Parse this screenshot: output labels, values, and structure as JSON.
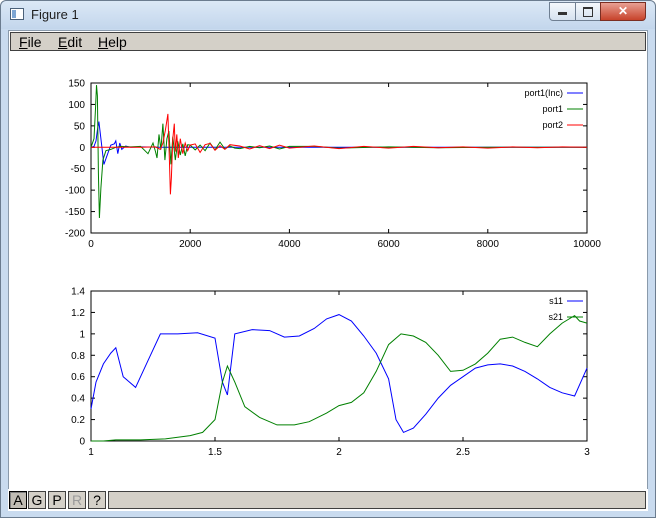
{
  "window": {
    "title": "Figure 1",
    "buttons": {
      "minimize": "minimize",
      "maximize": "maximize",
      "close": "✕"
    }
  },
  "menu": [
    {
      "label": "File",
      "mnemonic": "F",
      "rest": "ile"
    },
    {
      "label": "Edit",
      "mnemonic": "E",
      "rest": "dit"
    },
    {
      "label": "Help",
      "mnemonic": "H",
      "rest": "elp"
    }
  ],
  "toolbar": [
    {
      "label": "A",
      "state": "pressed"
    },
    {
      "label": "G",
      "state": "normal"
    },
    {
      "label": "P",
      "state": "normal"
    },
    {
      "label": "R",
      "state": "disabled"
    },
    {
      "label": "?",
      "state": "normal"
    }
  ],
  "colors": {
    "blue": "#0000ff",
    "green": "#008000",
    "red": "#ff0000"
  },
  "chart_data": [
    {
      "type": "line",
      "xlim": [
        0,
        10000
      ],
      "ylim": [
        -200,
        150
      ],
      "xticks": [
        0,
        2000,
        4000,
        6000,
        8000,
        10000
      ],
      "yticks": [
        -200,
        -150,
        -100,
        -50,
        0,
        50,
        100,
        150
      ],
      "legend_position": "top-right",
      "series": [
        {
          "name": "port1(Inc)",
          "color": "#0000ff",
          "x": [
            0,
            60,
            100,
            130,
            160,
            200,
            260,
            320,
            400,
            470,
            500,
            540,
            580,
            620,
            700,
            800,
            1000,
            1400,
            2000,
            3000,
            5000,
            7000,
            10000
          ],
          "y": [
            0,
            2,
            15,
            40,
            60,
            20,
            -40,
            -20,
            5,
            8,
            15,
            -15,
            10,
            -5,
            3,
            0,
            1,
            0,
            0,
            0,
            0,
            0,
            0
          ]
        },
        {
          "name": "port1",
          "color": "#008000",
          "x": [
            0,
            60,
            90,
            110,
            130,
            150,
            170,
            200,
            240,
            300,
            400,
            500,
            600,
            800,
            1000,
            1150,
            1250,
            1300,
            1330,
            1370,
            1410,
            1450,
            1490,
            1530,
            1570,
            1610,
            1650,
            1700,
            1750,
            1800,
            1850,
            1900,
            1950,
            2000,
            2100,
            2200,
            2300,
            2400,
            2500,
            2600,
            2700,
            2800,
            2900,
            3000,
            3200,
            3400,
            3600,
            3800,
            4000,
            4500,
            5000,
            6000,
            7000,
            8000,
            9000,
            10000
          ],
          "y": [
            0,
            20,
            90,
            145,
            120,
            -60,
            -165,
            -95,
            -30,
            -8,
            -5,
            0,
            2,
            1,
            2,
            -15,
            10,
            -10,
            -25,
            30,
            -5,
            55,
            -30,
            20,
            38,
            -40,
            25,
            -30,
            14,
            -18,
            8,
            -20,
            6,
            5,
            -6,
            5,
            -8,
            10,
            -6,
            12,
            -4,
            3,
            -2,
            -3,
            2,
            -1,
            3,
            -4,
            2,
            2,
            -2,
            1,
            -1,
            0,
            0,
            0
          ]
        },
        {
          "name": "port2",
          "color": "#ff0000",
          "x": [
            0,
            1000,
            1300,
            1400,
            1450,
            1500,
            1550,
            1580,
            1600,
            1620,
            1650,
            1680,
            1700,
            1730,
            1760,
            1800,
            1850,
            1900,
            1950,
            2000,
            2100,
            2200,
            2300,
            2400,
            2500,
            2600,
            2700,
            2800,
            3000,
            3200,
            3400,
            3600,
            3800,
            4000,
            4500,
            5000,
            5500,
            6000,
            6500,
            7000,
            7500,
            8000,
            8500,
            9000,
            9500,
            10000
          ],
          "y": [
            0,
            0,
            1,
            -5,
            10,
            40,
            78,
            -30,
            -110,
            -70,
            20,
            55,
            -10,
            30,
            -25,
            20,
            -15,
            10,
            -8,
            5,
            8,
            -12,
            6,
            9,
            -7,
            4,
            -5,
            6,
            3,
            -4,
            4,
            -3,
            5,
            -2,
            3,
            -3,
            2,
            -2,
            2,
            -1,
            1,
            -2,
            1,
            -1,
            1,
            0
          ]
        }
      ]
    },
    {
      "type": "line",
      "xlim": [
        1,
        3
      ],
      "ylim": [
        0,
        1.4
      ],
      "xticks": [
        1,
        1.5,
        2,
        2.5,
        3
      ],
      "yticks": [
        0,
        0.2,
        0.4,
        0.6,
        0.8,
        1,
        1.2,
        1.4
      ],
      "legend_position": "top-right",
      "series": [
        {
          "name": "s11",
          "color": "#0000ff",
          "x": [
            1.0,
            1.02,
            1.05,
            1.08,
            1.1,
            1.13,
            1.18,
            1.23,
            1.28,
            1.35,
            1.43,
            1.5,
            1.53,
            1.55,
            1.58,
            1.65,
            1.72,
            1.78,
            1.84,
            1.9,
            1.95,
            2.0,
            2.05,
            2.1,
            2.15,
            2.2,
            2.23,
            2.26,
            2.3,
            2.35,
            2.4,
            2.45,
            2.5,
            2.55,
            2.6,
            2.65,
            2.7,
            2.75,
            2.8,
            2.85,
            2.9,
            2.95,
            3.0
          ],
          "y": [
            0.3,
            0.55,
            0.72,
            0.82,
            0.87,
            0.6,
            0.5,
            0.75,
            1.0,
            1.0,
            1.01,
            0.96,
            0.55,
            0.43,
            1.0,
            1.04,
            1.03,
            0.97,
            0.98,
            1.05,
            1.14,
            1.18,
            1.12,
            0.98,
            0.82,
            0.58,
            0.2,
            0.08,
            0.12,
            0.25,
            0.4,
            0.52,
            0.6,
            0.68,
            0.71,
            0.72,
            0.7,
            0.65,
            0.58,
            0.5,
            0.45,
            0.42,
            0.68
          ]
        },
        {
          "name": "s21",
          "color": "#008000",
          "x": [
            1.0,
            1.05,
            1.1,
            1.2,
            1.3,
            1.4,
            1.45,
            1.5,
            1.53,
            1.55,
            1.58,
            1.62,
            1.68,
            1.75,
            1.82,
            1.88,
            1.95,
            2.0,
            2.05,
            2.1,
            2.15,
            2.2,
            2.25,
            2.3,
            2.35,
            2.4,
            2.45,
            2.5,
            2.55,
            2.6,
            2.65,
            2.7,
            2.75,
            2.8,
            2.85,
            2.9,
            2.95,
            2.97,
            3.0
          ],
          "y": [
            0.0,
            0.0,
            0.01,
            0.01,
            0.02,
            0.05,
            0.08,
            0.2,
            0.55,
            0.7,
            0.55,
            0.32,
            0.22,
            0.15,
            0.15,
            0.18,
            0.26,
            0.33,
            0.36,
            0.45,
            0.65,
            0.9,
            1.0,
            0.98,
            0.92,
            0.8,
            0.65,
            0.66,
            0.72,
            0.82,
            0.95,
            0.97,
            0.92,
            0.88,
            1.0,
            1.1,
            1.17,
            1.12,
            1.1
          ]
        }
      ]
    }
  ]
}
